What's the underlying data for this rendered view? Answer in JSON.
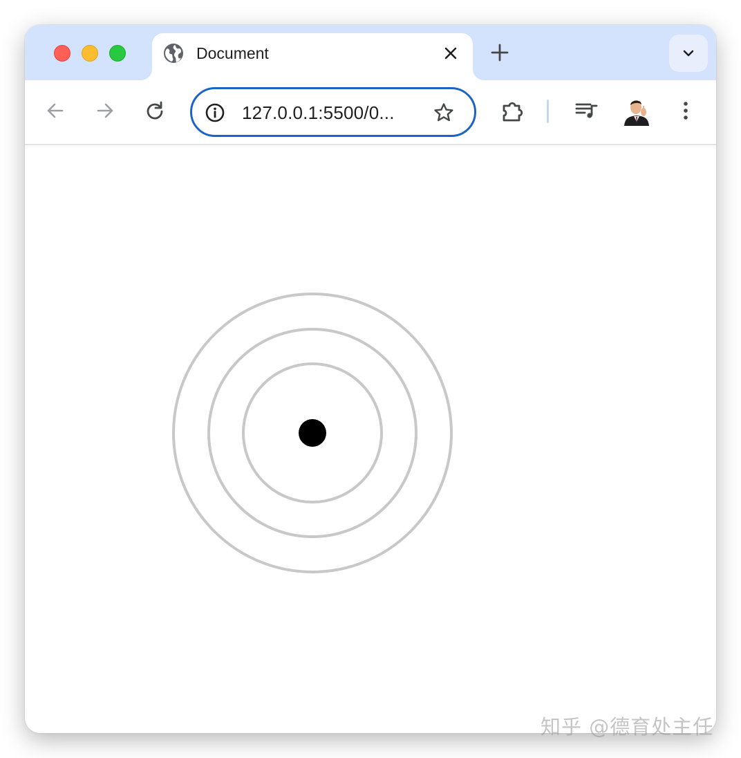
{
  "browser": {
    "tab": {
      "title": "Document",
      "favicon": "globe-icon"
    },
    "address_bar": {
      "url": "127.0.0.1:5500/0..."
    },
    "colors": {
      "tabstrip": "#d3e3fd",
      "omnibox_border": "#1b63c7",
      "close_dot": "#ff5f57",
      "minimize_dot": "#febc2e",
      "maximize_dot": "#28c840"
    },
    "icons": {
      "back": "arrow-left-icon",
      "forward": "arrow-right-icon",
      "reload": "reload-icon",
      "site_info": "info-icon",
      "bookmark": "star-icon",
      "extensions": "puzzle-icon",
      "media": "playlist-music-icon",
      "menu": "kebab-menu-icon",
      "new_tab": "plus-icon",
      "tab_search": "chevron-down-icon",
      "tab_close": "close-icon"
    }
  },
  "page": {
    "rings": [
      {
        "name": "outer-ring",
        "color": "#c8c8c8"
      },
      {
        "name": "middle-ring",
        "color": "#c8c8c8"
      },
      {
        "name": "inner-ring",
        "color": "#c8c8c8"
      }
    ],
    "center_dot": {
      "color": "#000000"
    }
  },
  "watermark": {
    "text": "知乎 @德育处主任"
  }
}
